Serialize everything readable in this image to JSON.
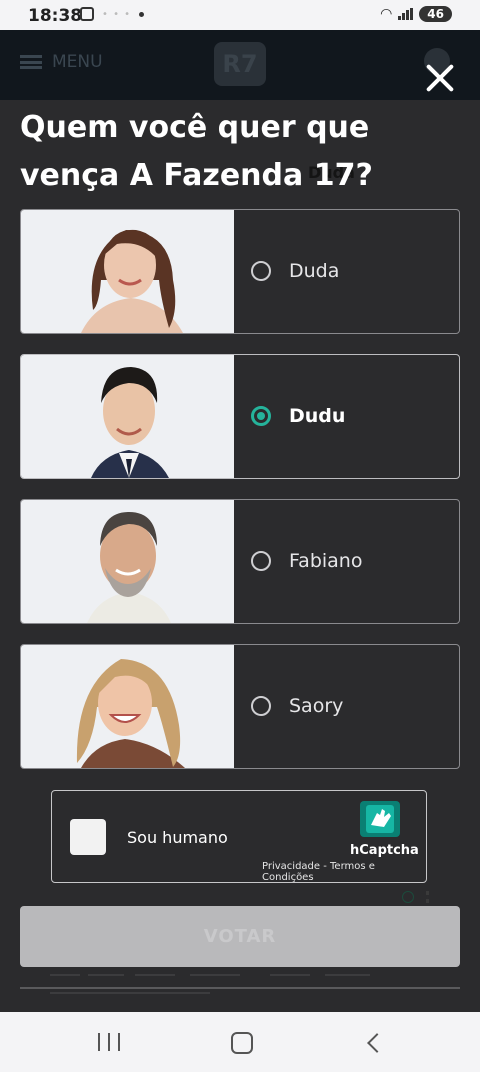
{
  "status": {
    "time": "18:38",
    "battery": "46"
  },
  "background_page": {
    "menu_label": "MENU",
    "logo": "R7",
    "candidate_label": "Duda"
  },
  "poll": {
    "title": "Quem você quer que vença A Fazenda 17?",
    "options": [
      {
        "name": "Duda",
        "selected": false
      },
      {
        "name": "Dudu",
        "selected": true
      },
      {
        "name": "Fabiano",
        "selected": false
      },
      {
        "name": "Saory",
        "selected": false
      }
    ],
    "selected_color": "#25b39b"
  },
  "captcha": {
    "label": "Sou humano",
    "brand": "hCaptcha",
    "links": "Privacidade - Termos e Condições",
    "checked": false
  },
  "vote_button": {
    "label": "VOTAR",
    "enabled": false
  },
  "nav": {
    "icons": [
      "recents-icon",
      "home-icon",
      "back-icon"
    ]
  }
}
